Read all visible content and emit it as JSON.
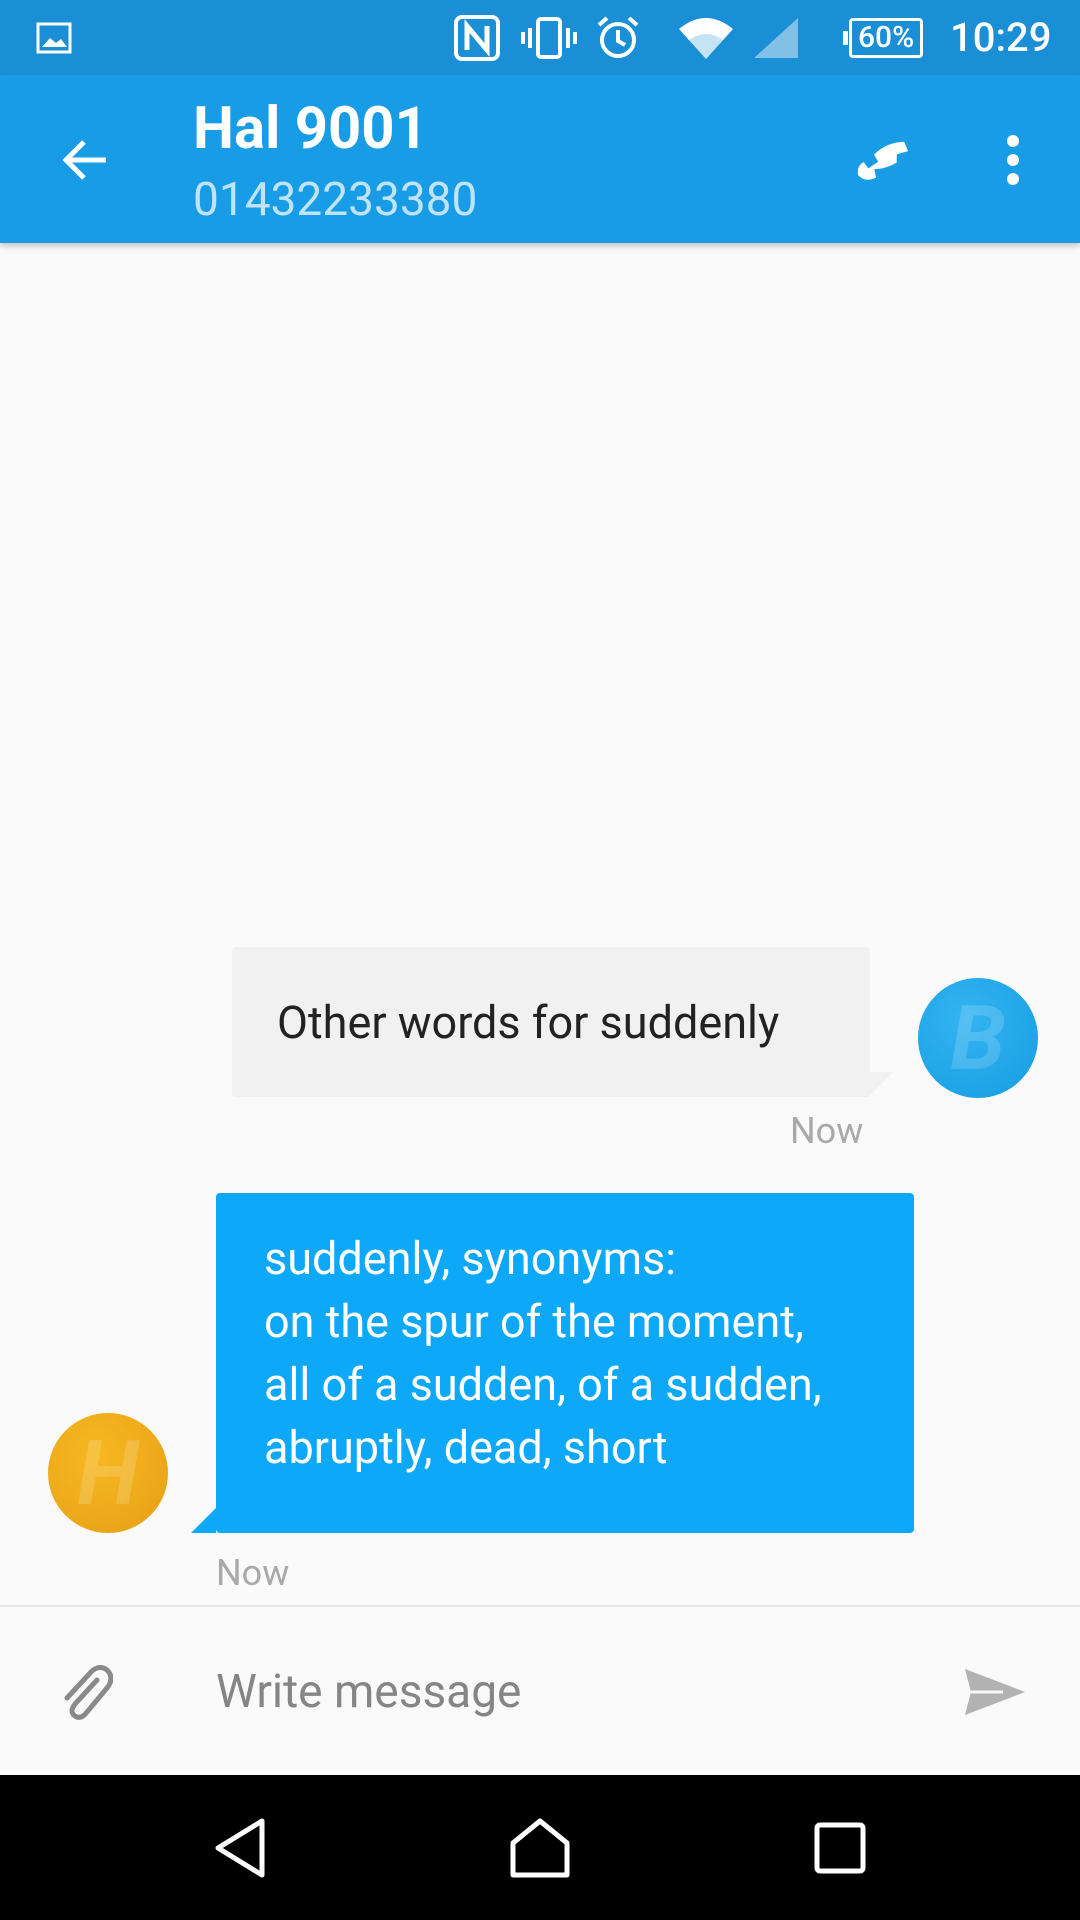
{
  "status_bar": {
    "battery": "60%",
    "time": "10:29",
    "icons": [
      "image-notification-icon",
      "nfc-icon",
      "vibrate-icon",
      "alarm-icon",
      "wifi-icon",
      "signal-icon",
      "battery-icon"
    ]
  },
  "app_bar": {
    "title": "Hal 9001",
    "subtitle": "01432233380",
    "icons": [
      "back-arrow-icon",
      "phone-call-icon",
      "more-vert-icon"
    ]
  },
  "messages": [
    {
      "direction": "incoming",
      "text": "Other words for suddenly",
      "time": "Now",
      "avatar_letter": "B"
    },
    {
      "direction": "outgoing",
      "lines": [
        "suddenly, synonyms:",
        "on the spur of the moment,",
        "all of a sudden, of a sudden,",
        "abruptly, dead, short"
      ],
      "time": "Now",
      "avatar_letter": "H"
    }
  ],
  "composer": {
    "placeholder": "Write message",
    "icons": [
      "attach-icon",
      "send-icon"
    ]
  },
  "nav_bar": {
    "icons": [
      "back-nav-icon",
      "home-nav-icon",
      "recents-nav-icon"
    ]
  },
  "colors": {
    "status_bar": "#1a8fd6",
    "app_bar": "#189ce6",
    "outgoing_bubble": "#0ea8f8",
    "incoming_bubble": "#f1f1f1",
    "avatar_b": "#1f9fe6",
    "avatar_h": "#f2ad19"
  }
}
